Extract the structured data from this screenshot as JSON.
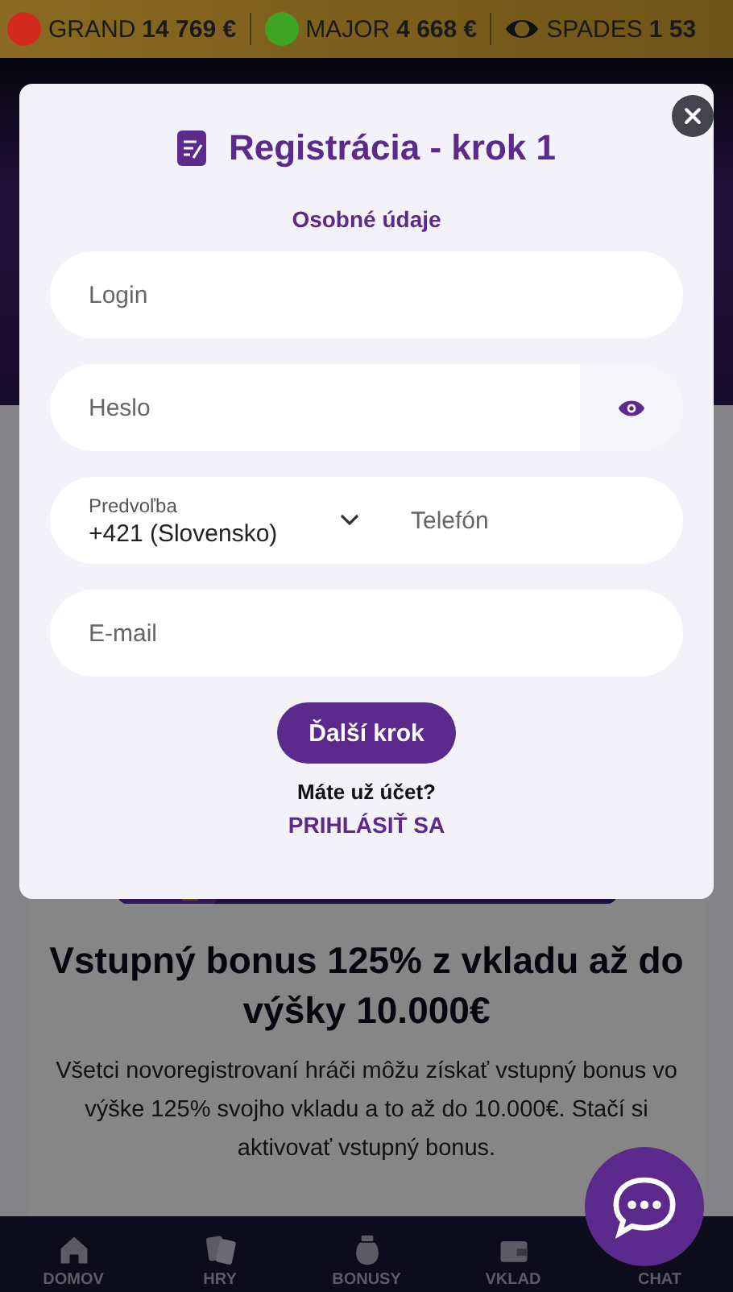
{
  "jackpots": [
    {
      "name": "GRAND",
      "amount": "14 769 €",
      "kind": "coin",
      "color": "#d42a1e"
    },
    {
      "name": "MAJOR",
      "amount": "4 668 €",
      "kind": "coin",
      "color": "#3fa423"
    },
    {
      "name": "SPADES",
      "amount": "1 53",
      "kind": "eye",
      "color": "#111111"
    }
  ],
  "promo": {
    "title": "Vstupný bonus 125% z vkladu až do výšky 10.000€",
    "text": "Všetci novoregistrovaní hráči môžu získať vstupný bonus vo výške 125% svojho vkladu a to až do 10.000€. Stačí si aktivovať vstupný bonus."
  },
  "bottom_nav": [
    {
      "label": "DOMOV",
      "kind": "home"
    },
    {
      "label": "HRY",
      "kind": "cards"
    },
    {
      "label": "BONUSY",
      "kind": "bag"
    },
    {
      "label": "VKLAD",
      "kind": "wallet"
    },
    {
      "label": "CHAT",
      "kind": "chat"
    }
  ],
  "modal": {
    "title": "Registrácia - krok 1",
    "section": "Osobné údaje",
    "login": {
      "placeholder": "Login"
    },
    "password": {
      "placeholder": "Heslo"
    },
    "prefix": {
      "label": "Predvoľba",
      "value": "+421 (Slovensko)"
    },
    "phone": {
      "placeholder": "Telefón"
    },
    "email": {
      "placeholder": "E-mail"
    },
    "next_button": "Ďalší krok",
    "account_question": "Máte už účet?",
    "login_link": "PRIHLÁSIŤ SA"
  }
}
